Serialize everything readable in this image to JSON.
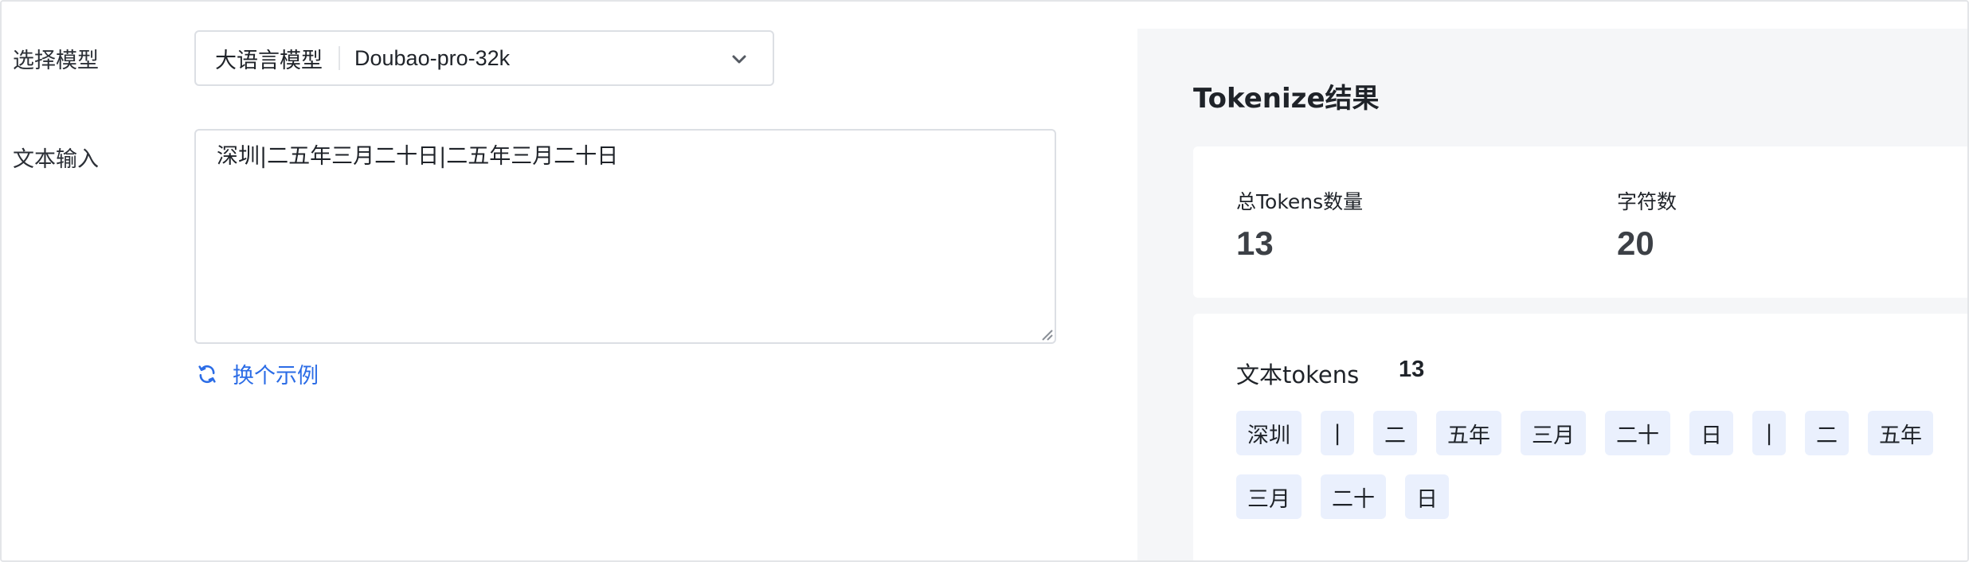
{
  "form": {
    "model_label": "选择模型",
    "model_type": "大语言模型",
    "model_value": "Doubao-pro-32k",
    "text_label": "文本输入",
    "text_value": "深圳|二五年三月二十日|二五年三月二十日",
    "swap_label": "换个示例"
  },
  "result": {
    "title": "Tokenize结果",
    "total_tokens_label": "总Tokens数量",
    "total_tokens_value": "13",
    "char_count_label": "字符数",
    "char_count_value": "20",
    "text_tokens_label": "文本tokens",
    "text_tokens_count": "13",
    "tokens": [
      "深圳",
      "|",
      "二",
      "五年",
      "三月",
      "二十",
      "日",
      "|",
      "二",
      "五年",
      "三月",
      "二十",
      "日"
    ]
  },
  "colors": {
    "accent": "#2b6ce6",
    "panel_bg": "#f5f6f8",
    "chip_bg": "#eaf0fd"
  }
}
